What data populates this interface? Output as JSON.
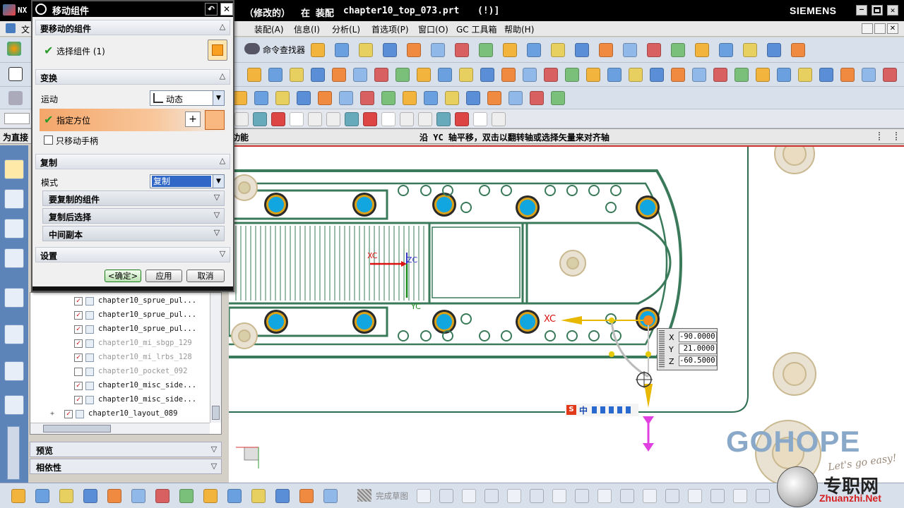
{
  "titlebar": {
    "app": "NX",
    "status": "（修改的）",
    "context": "在 装配",
    "file": "chapter10_top_073.prt",
    "flag": "(!)]",
    "brand": "SIEMENS"
  },
  "menubar": {
    "items": [
      "文",
      "装配(A)",
      "信息(I)",
      "分析(L)",
      "首选项(P)",
      "窗口(O)",
      "GC 工具箱",
      "帮助(H)"
    ],
    "command_finder": "命令查找器"
  },
  "statusbar": {
    "left": "为直接",
    "cue_left": "功能",
    "cue": "沿 YC 轴平移，双击以翻转轴或选择矢量来对齐轴"
  },
  "dialog": {
    "title": "移动组件",
    "sections": {
      "components": {
        "header": "要移动的组件",
        "select_label": "选择组件 (1)"
      },
      "transform": {
        "header": "变换",
        "motion_label": "运动",
        "motion_value": "动态",
        "orient_label": "指定方位",
        "only_handle_label": "只移动手柄"
      },
      "copy": {
        "header": "复制",
        "mode_label": "模式",
        "mode_value": "复制",
        "sub1": "要复制的组件",
        "sub2": "复制后选择",
        "sub3": "中间副本"
      },
      "settings": {
        "header": "设置"
      }
    },
    "buttons": {
      "ok": "<确定>",
      "apply": "应用",
      "cancel": "取消"
    }
  },
  "navigator": {
    "rows": [
      {
        "label": "chapter10_sprue_pul...",
        "checked": true,
        "dim": false
      },
      {
        "label": "chapter10_sprue_pul...",
        "checked": true,
        "dim": false
      },
      {
        "label": "chapter10_sprue_pul...",
        "checked": true,
        "dim": false
      },
      {
        "label": "chapter10_mi_sbgp_129",
        "checked": true,
        "dim": true
      },
      {
        "label": "chapter10_mi_lrbs_128",
        "checked": true,
        "dim": true
      },
      {
        "label": "chapter10_pocket_092",
        "checked": false,
        "dim": true
      },
      {
        "label": "chapter10_misc_side...",
        "checked": true,
        "dim": false
      },
      {
        "label": "chapter10_misc_side...",
        "checked": true,
        "dim": false
      },
      {
        "label": "chapter10_layout_089",
        "checked": true,
        "dim": false
      }
    ],
    "preview": "预览",
    "dependency": "相依性"
  },
  "viewport": {
    "coords": {
      "x_label": "X",
      "x": "-90.0000",
      "y_label": "Y",
      "y": "21.0000",
      "z_label": "Z",
      "z": "-60.5000"
    },
    "axis_labels": {
      "xc": "XC",
      "zc": "ZC",
      "yc": "YC",
      "xc2": "XC"
    },
    "ime": "中",
    "watermark": "GOHOPE",
    "tagline": "Let's go easy!",
    "site_cn": "专职网",
    "site_url": "Zhuanzhi.Net"
  },
  "bottombar": {
    "finish_sketch": "完成草图"
  },
  "colors": {
    "accent_orange": "#f0a060",
    "part_green": "#3a7a5a",
    "hole_blue": "#12a6e0",
    "hole_ring": "#d9a21a",
    "watermark": "#8aa8c8"
  }
}
